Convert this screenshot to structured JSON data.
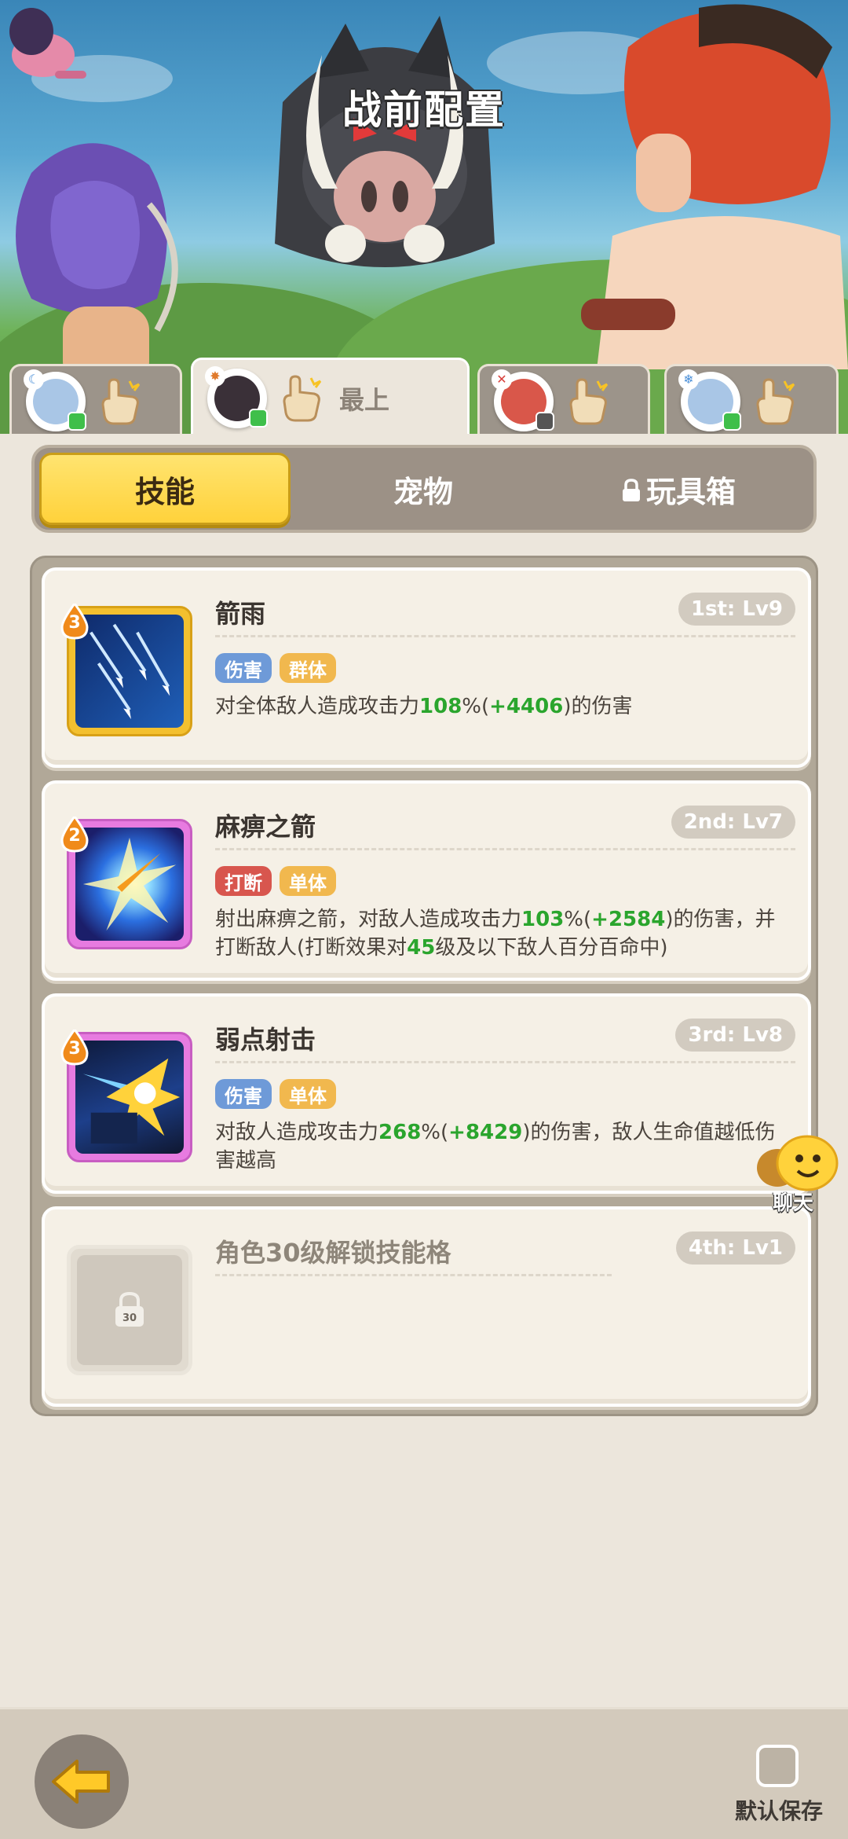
{
  "page": {
    "title": "战前配置"
  },
  "hero_tabs": [
    {
      "id": "hero-1",
      "element_glyph": "☾",
      "element_color": "#4a8fd8",
      "face_color": "#a9c6e6",
      "status_color": "#3fbf4a",
      "label": ""
    },
    {
      "id": "hero-2",
      "element_glyph": "✸",
      "element_color": "#e07a2c",
      "face_color": "#3a3038",
      "status_color": "#3fbf4a",
      "label": "最上",
      "active": true
    },
    {
      "id": "hero-3",
      "element_glyph": "✕",
      "element_color": "#d8403c",
      "face_color": "#d9574a",
      "status_color": "#555555",
      "label": ""
    },
    {
      "id": "hero-4",
      "element_glyph": "❄",
      "element_color": "#4a8fd8",
      "face_color": "#a9c6e6",
      "status_color": "#3fbf4a",
      "label": ""
    }
  ],
  "segments": {
    "skills": "技能",
    "pets": "宠物",
    "toybox": "玩具箱"
  },
  "skills": [
    {
      "name": "箭雨",
      "slot": "1st: Lv9",
      "level": "3",
      "icon_frame": "gold",
      "tags": [
        {
          "text": "伤害",
          "color": "blue"
        },
        {
          "text": "群体",
          "color": "orange"
        }
      ],
      "desc": {
        "pre": "对全体敌人造成攻击力",
        "pct": "108",
        "pct_unit": "%(",
        "bonus": "+4406",
        "post": ")的伤害",
        "line2": ""
      }
    },
    {
      "name": "麻痹之箭",
      "slot": "2nd: Lv7",
      "level": "2",
      "icon_frame": "purple",
      "tags": [
        {
          "text": "打断",
          "color": "red"
        },
        {
          "text": "单体",
          "color": "orange"
        }
      ],
      "desc": {
        "pre": "射出麻痹之箭，对敌人造成攻击力",
        "pct": "103",
        "pct_unit": "%(",
        "bonus": "+2584",
        "post": ")的伤害，并",
        "line2_pre": "打断敌人(打断效果对",
        "line2_num": "45",
        "line2_post": "级及以下敌人百分百命中)"
      }
    },
    {
      "name": "弱点射击",
      "slot": "3rd: Lv8",
      "level": "3",
      "icon_frame": "purple",
      "tags": [
        {
          "text": "伤害",
          "color": "blue"
        },
        {
          "text": "单体",
          "color": "orange"
        }
      ],
      "desc": {
        "pre": "对敌人造成攻击力",
        "pct": "268",
        "pct_unit": "%(",
        "bonus": "+8429",
        "post": ")的伤害，敌人生命值越低伤",
        "line2_plain": "害越高"
      }
    },
    {
      "name": "角色30级解锁技能格",
      "slot": "4th: Lv1",
      "locked": true,
      "lock_level": "30"
    }
  ],
  "chat": {
    "label": "聊天"
  },
  "footer": {
    "default_save": "默认保存"
  },
  "colors": {
    "accent_yellow": "#ffd23b",
    "number_green": "#2aa52d",
    "panel_bg": "#ece6dc"
  }
}
